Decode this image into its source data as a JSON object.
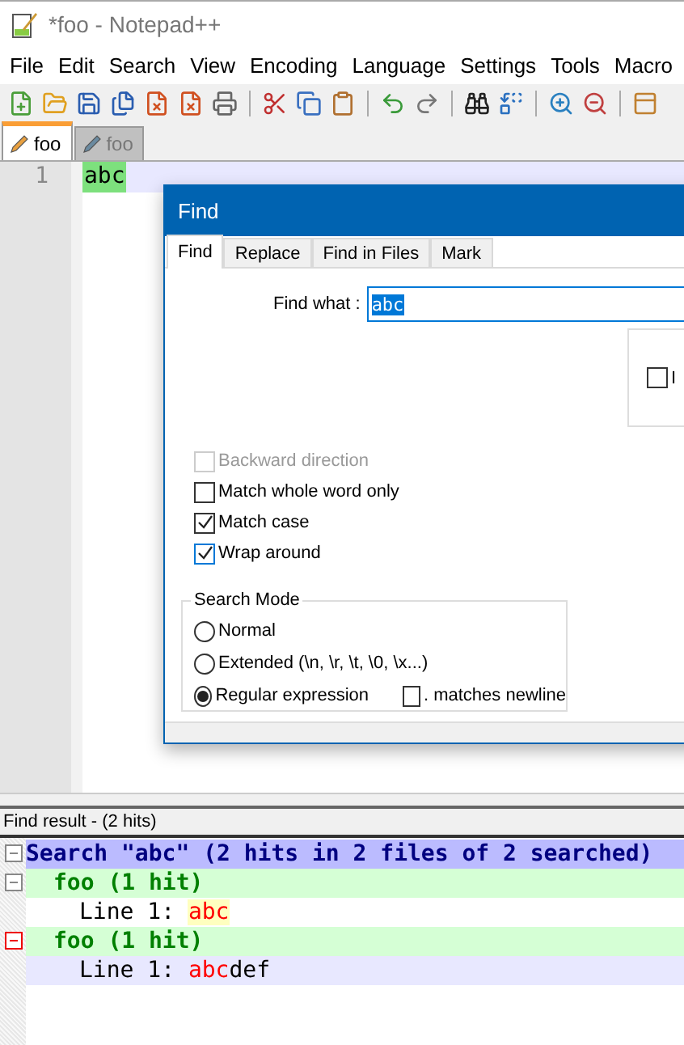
{
  "window": {
    "title": "*foo - Notepad++"
  },
  "menu": [
    "File",
    "Edit",
    "Search",
    "View",
    "Encoding",
    "Language",
    "Settings",
    "Tools",
    "Macro"
  ],
  "tabs": [
    {
      "label": "foo",
      "selected": true
    },
    {
      "label": "foo",
      "selected": false
    }
  ],
  "editor": {
    "lines": [
      {
        "number": "1",
        "text": "abc",
        "current": true,
        "highlighted": true
      }
    ]
  },
  "find_dialog": {
    "title": "Find",
    "tabs": [
      {
        "label": "Find",
        "selected": true
      },
      {
        "label": "Replace",
        "selected": false
      },
      {
        "label": "Find in Files",
        "selected": false
      },
      {
        "label": "Mark",
        "selected": false
      }
    ],
    "find_what": {
      "label": "Find what :",
      "value": "abc"
    },
    "side_checkbox": {
      "label": "I",
      "checked": false
    },
    "options": [
      {
        "label": "Backward direction",
        "checked": false,
        "disabled": true
      },
      {
        "label": "Match whole word only",
        "checked": false,
        "disabled": false
      },
      {
        "label": "Match case",
        "checked": true,
        "disabled": false
      },
      {
        "label": "Wrap around",
        "checked": true,
        "disabled": false
      }
    ],
    "search_mode": {
      "title": "Search Mode",
      "options": [
        {
          "label": "Normal",
          "selected": false
        },
        {
          "label": "Extended (\\n, \\r, \\t, \\0, \\x...)",
          "selected": false
        },
        {
          "label": "Regular expression",
          "selected": true
        }
      ],
      "dot_newline": {
        "label": ". matches newline",
        "checked": false
      }
    }
  },
  "find_result": {
    "title": "Find result - (2 hits)",
    "items": [
      {
        "kind": "search",
        "text": "Search \"abc\" (2 hits in 2 files of 2 searched)",
        "current": false,
        "children": [
          {
            "kind": "file",
            "text": "foo (1 hit)",
            "current": false,
            "children": [
              {
                "kind": "line",
                "prefix": "Line 1: ",
                "match": "abc",
                "current": false
              }
            ]
          },
          {
            "kind": "file",
            "text": "foo (1 hit)",
            "current": true,
            "children": [
              {
                "kind": "line",
                "prefix": "Line 1: ",
                "match": "abc",
                "rest": "def",
                "current": true
              }
            ]
          }
        ]
      }
    ]
  }
}
